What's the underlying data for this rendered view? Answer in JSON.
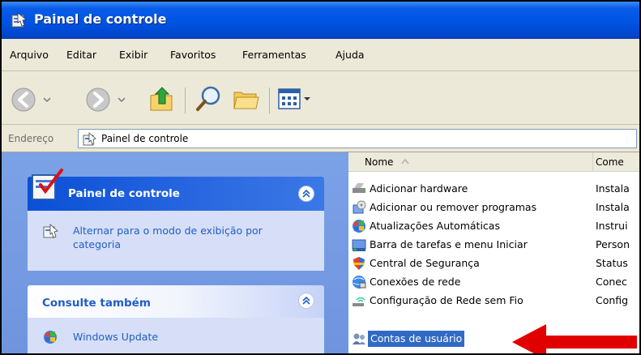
{
  "window": {
    "title": "Painel de controle"
  },
  "menu": [
    "Arquivo",
    "Editar",
    "Exibir",
    "Favoritos",
    "Ferramentas",
    "Ajuda"
  ],
  "toolbar": {
    "buttons": [
      "back-icon",
      "forward-icon",
      "up-folder-icon",
      "search-icon",
      "folders-icon",
      "views-icon"
    ]
  },
  "address": {
    "label": "Endereço",
    "value": "Painel de controle"
  },
  "task_pane": {
    "box1": {
      "title": "Painel de controle",
      "link": "Alternar para o modo de exibição por categoria"
    },
    "box2": {
      "title": "Consulte também",
      "link": "Windows Update"
    }
  },
  "list": {
    "columns": {
      "name": "Nome",
      "comment": "Come"
    },
    "items": [
      {
        "name": "Adicionar hardware",
        "comment": "Instala",
        "icon": "hardware-icon"
      },
      {
        "name": "Adicionar ou remover programas",
        "comment": "Instala",
        "icon": "add-remove-programs-icon"
      },
      {
        "name": "Atualizações Automáticas",
        "comment": "Instrui",
        "icon": "windows-update-icon"
      },
      {
        "name": "Barra de tarefas e menu Iniciar",
        "comment": "Person",
        "icon": "taskbar-icon"
      },
      {
        "name": "Central de Segurança",
        "comment": "Status",
        "icon": "security-shield-icon"
      },
      {
        "name": "Conexões de rede",
        "comment": "Conec",
        "icon": "network-icon"
      },
      {
        "name": "Configuração de Rede sem Fio",
        "comment": "Config",
        "icon": "wireless-icon"
      },
      {
        "name": "Contas de usuário",
        "comment": "",
        "icon": "user-accounts-icon",
        "selected": true
      }
    ]
  },
  "colors": {
    "selection": "#316ac5",
    "arrow": "#e00000",
    "link": "#215dc6",
    "title_bar": "#0055e5"
  }
}
